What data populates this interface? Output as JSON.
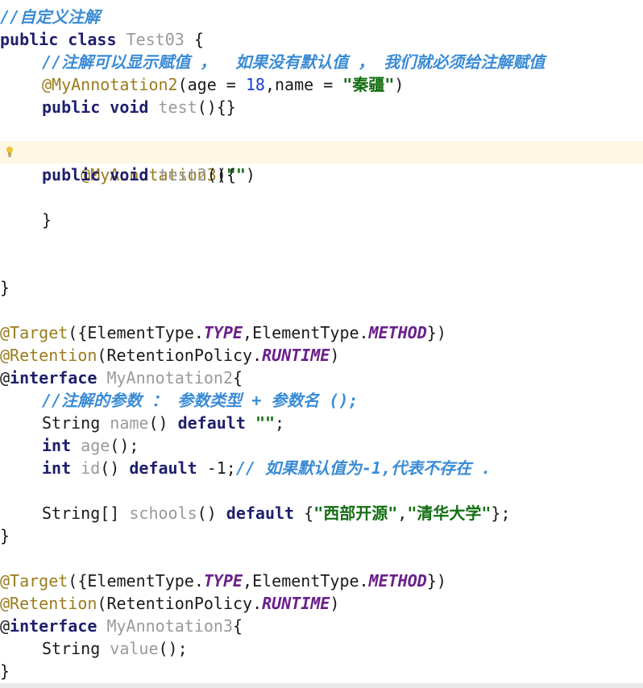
{
  "code": {
    "l1_comment": "//自定义注解",
    "l2_public": "public",
    "l2_class": "class",
    "l2_name": "Test03",
    "l2_brace": " {",
    "l3_comment": "//注解可以显示赋值 ，  如果没有默认值 ， 我们就必须给注解赋值",
    "l4_ann": "@MyAnnotation2",
    "l4_p1": "(age = ",
    "l4_num": "18",
    "l4_p2": ",name = ",
    "l4_str": "\"秦疆\"",
    "l4_p3": ")",
    "l5_public": "public",
    "l5_void": "void",
    "l5_method": "test",
    "l5_rest": "(){}",
    "l7_ann": "@MyAnnotation3",
    "l7_p1": "(",
    "l7_str": "\"\"",
    "l7_p2": ")",
    "l8_public": "public",
    "l8_void": "void",
    "l8_method": "test2",
    "l8_rest": "(){",
    "l10_brace": "}",
    "l13_brace": "}",
    "target_ann": "@Target",
    "target_p1": "({ElementType.",
    "target_type": "TYPE",
    "target_p2": ",ElementType.",
    "target_method": "METHOD",
    "target_p3": "})",
    "retention_ann": "@Retention",
    "retention_p1": "(RetentionPolicy.",
    "retention_runtime": "RUNTIME",
    "retention_p2": ")",
    "iface_at": "@",
    "iface_kw": "interface",
    "iface2_name": "MyAnnotation2",
    "iface_brace": "{",
    "l18_comment": "//注解的参数 ： 参数类型 + 参数名 ();",
    "l19_type": "String",
    "l19_name": "name",
    "l19_p1": "() ",
    "l19_default": "default",
    "l19_str": "\"\"",
    "l19_semi": ";",
    "l20_int": "int",
    "l20_name": "age",
    "l20_rest": "();",
    "l21_int": "int",
    "l21_name": "id",
    "l21_p1": "() ",
    "l21_default": "default",
    "l21_val": " -1;",
    "l21_comment": "// 如果默认值为-1,代表不存在 .",
    "l23_type": "String[]",
    "l23_name": "schools",
    "l23_p1": "() ",
    "l23_default": "default",
    "l23_p2": " {",
    "l23_str1": "\"西部开源\"",
    "l23_comma": ",",
    "l23_str2": "\"清华大学\"",
    "l23_p3": "};",
    "l24_brace": "}",
    "iface3_name": "MyAnnotation3",
    "l29_type": "String",
    "l29_name": "value",
    "l29_rest": "();",
    "l30_brace": "}"
  },
  "gutter": {
    "icon": "lightbulb-icon"
  }
}
